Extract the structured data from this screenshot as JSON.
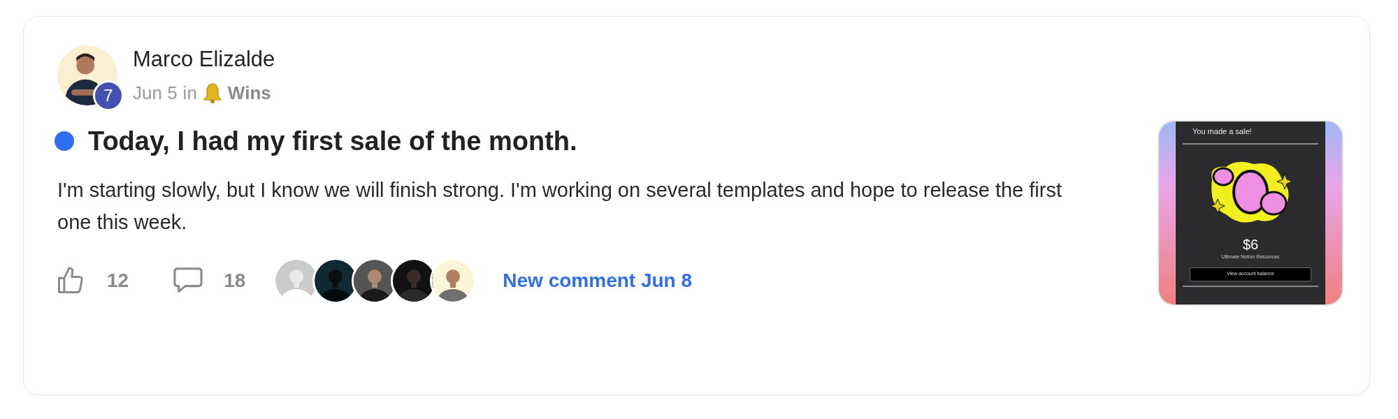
{
  "post": {
    "author": {
      "name": "Marco Elizalde",
      "level_badge": "7"
    },
    "meta": {
      "date": "Jun 5",
      "preposition": "in",
      "category": "Wins"
    },
    "unread": true,
    "title": "Today, I had my first sale of the month.",
    "body": "I'm starting slowly, but I know we will finish strong. I'm working on several templates and hope to release the first one this week.",
    "likes": "12",
    "comments": "18",
    "new_comment": "New comment Jun 8",
    "attachment": {
      "heading": "You made a sale!",
      "amount": "$6",
      "product": "Ultimate Notion Resources",
      "button": "View account balance"
    }
  }
}
